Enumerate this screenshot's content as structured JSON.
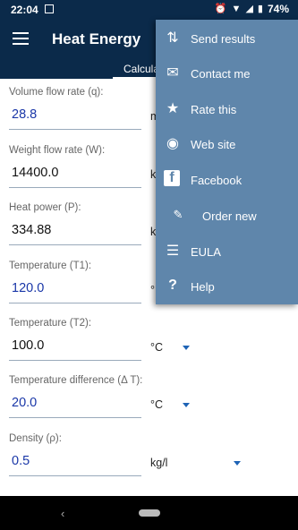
{
  "status_bar": {
    "time": "22:04",
    "battery": "74%"
  },
  "app_bar": {
    "title": "Heat Energy",
    "active_tab": "Calcula"
  },
  "fields": [
    {
      "label": "Volume flow rate (q):",
      "value": "28.8",
      "unit": "m"
    },
    {
      "label": "Weight flow rate (W):",
      "value": "14400.0",
      "unit": "k"
    },
    {
      "label": "Heat power (P):",
      "value": "334.88",
      "unit": "k"
    },
    {
      "label": "Temperature (T1):",
      "value": "120.0",
      "unit": "°"
    },
    {
      "label": "Temperature (T2):",
      "value": "100.0",
      "unit": "°C"
    },
    {
      "label": "Temperature difference (Δ T):",
      "value": "20.0",
      "unit": "°C"
    },
    {
      "label": "Density (ρ):",
      "value": "0.5",
      "unit": "kg/l"
    }
  ],
  "menu": {
    "items": [
      {
        "label": "Send results",
        "icon": "send-results-icon"
      },
      {
        "label": "Contact me",
        "icon": "mail-icon"
      },
      {
        "label": "Rate this",
        "icon": "star-icon"
      },
      {
        "label": "Web site",
        "icon": "globe-icon"
      },
      {
        "label": "Facebook",
        "icon": "facebook-icon"
      },
      {
        "label": "Order new",
        "icon": "order-new-icon"
      },
      {
        "label": "EULA",
        "icon": "document-icon"
      },
      {
        "label": "Help",
        "icon": "help-icon"
      }
    ]
  },
  "colors": {
    "appbar": "#0b2a4a",
    "menu_bg": "#5f86ab",
    "accent_blue": "#1a37a8"
  }
}
